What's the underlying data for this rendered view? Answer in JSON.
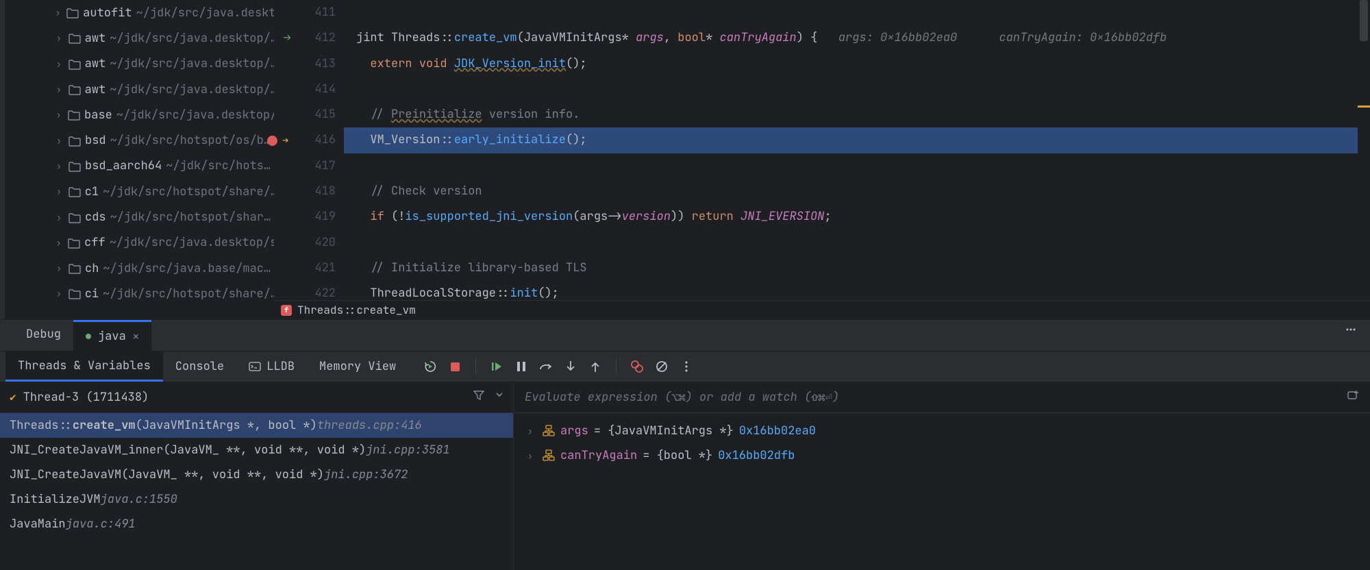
{
  "tree": [
    {
      "name": "autofit",
      "path": "~/jdk/src/java.desktop/…"
    },
    {
      "name": "awt",
      "path": "~/jdk/src/java.desktop/…"
    },
    {
      "name": "awt",
      "path": "~/jdk/src/java.desktop/…"
    },
    {
      "name": "awt",
      "path": "~/jdk/src/java.desktop/…"
    },
    {
      "name": "base",
      "path": "~/jdk/src/java.desktop/…"
    },
    {
      "name": "bsd",
      "path": "~/jdk/src/hotspot/os/b…"
    },
    {
      "name": "bsd_aarch64",
      "path": "~/jdk/src/hots…"
    },
    {
      "name": "c1",
      "path": "~/jdk/src/hotspot/share/…"
    },
    {
      "name": "cds",
      "path": "~/jdk/src/hotspot/shar…"
    },
    {
      "name": "cff",
      "path": "~/jdk/src/java.desktop/s…"
    },
    {
      "name": "ch",
      "path": "~/jdk/src/java.base/mac…"
    },
    {
      "name": "ci",
      "path": "~/jdk/src/hotspot/share/…"
    }
  ],
  "editor": {
    "lines": [
      {
        "n": "411",
        "t": ""
      },
      {
        "n": "412",
        "t": "code_412",
        "startFn": true
      },
      {
        "n": "413",
        "t": "code_413"
      },
      {
        "n": "414",
        "t": ""
      },
      {
        "n": "415",
        "t": "code_415"
      },
      {
        "n": "416",
        "t": "code_416",
        "bp": true,
        "exec": true
      },
      {
        "n": "417",
        "t": ""
      },
      {
        "n": "418",
        "t": "code_418"
      },
      {
        "n": "419",
        "t": "code_419"
      },
      {
        "n": "420",
        "t": ""
      },
      {
        "n": "421",
        "t": "code_421"
      },
      {
        "n": "422",
        "t": "code_422"
      }
    ],
    "hints": {
      "args": "args: 0x16bb02ea0",
      "canTryAgain": "canTryAgain: 0x16bb02dfb"
    }
  },
  "breadcrumb": "Threads::create_vm",
  "tabs": {
    "debug": "Debug",
    "file": "java"
  },
  "dbgTabs": [
    "Threads & Variables",
    "Console",
    "LLDB",
    "Memory View"
  ],
  "thread": "Thread-3 (1711438)",
  "frames": [
    {
      "fn": "Threads::",
      "fn2": "create_vm",
      "sig": "(JavaVMInitArgs *, bool *) ",
      "loc": "threads.cpp:416",
      "sel": true
    },
    {
      "fn": "JNI_CreateJavaVM_inner",
      "sig": "(JavaVM_ **, void **, void *) ",
      "loc": "jni.cpp:3581"
    },
    {
      "fn": "JNI_CreateJavaVM",
      "sig": "(JavaVM_ **, void **, void *) ",
      "loc": "jni.cpp:3672"
    },
    {
      "fn": "InitializeJVM ",
      "loc": "java.c:1550"
    },
    {
      "fn": "JavaMain ",
      "loc": "java.c:491"
    }
  ],
  "evalPlaceholder": "Evaluate expression (⌥⌘) or add a watch (⇧⌘⏎)",
  "vars": [
    {
      "name": "args",
      "assign": " = ",
      "type": "{JavaVMInitArgs *} ",
      "addr": "0x16bb02ea0"
    },
    {
      "name": "canTryAgain",
      "assign": " = ",
      "type": "{bool *} ",
      "addr": "0x16bb02dfb"
    }
  ]
}
